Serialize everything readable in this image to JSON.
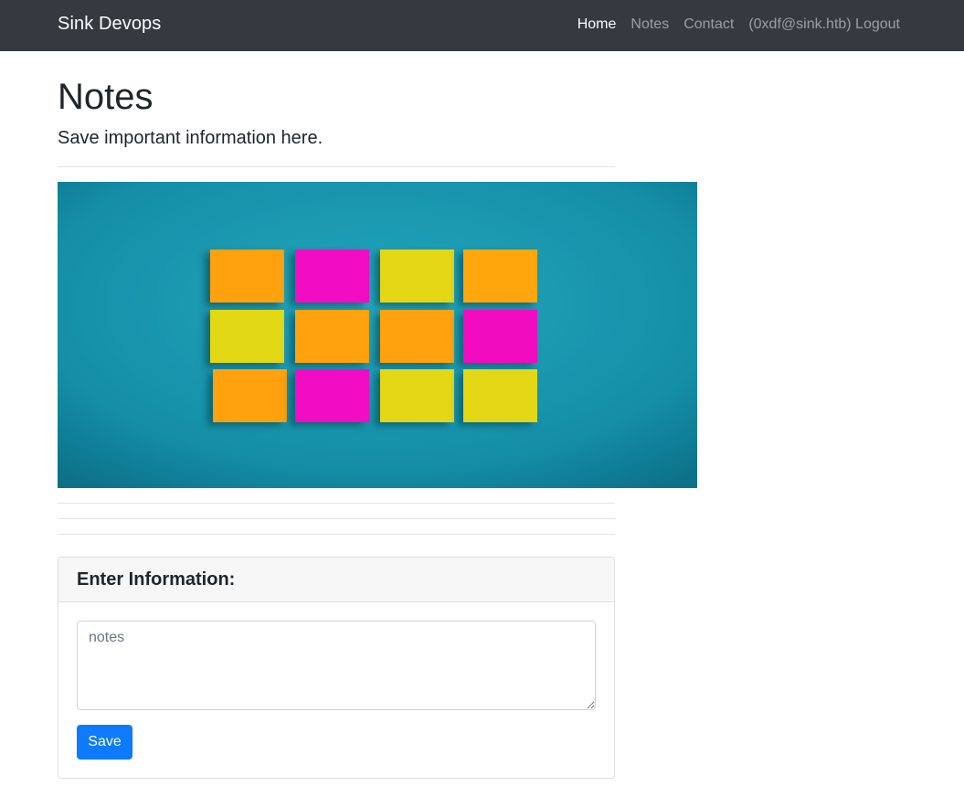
{
  "navbar": {
    "brand": "Sink Devops",
    "links": [
      {
        "label": "Home",
        "active": true
      },
      {
        "label": "Notes",
        "active": false
      },
      {
        "label": "Contact",
        "active": false
      },
      {
        "label": "(0xdf@sink.htb) Logout",
        "active": false
      }
    ]
  },
  "header": {
    "title": "Notes",
    "lead": "Save important information here."
  },
  "hero_image": {
    "background_color": "#1a9ab3",
    "note_colors": [
      [
        "#ffa20e",
        "#f20bc4",
        "#e3d718",
        "#ffa70a"
      ],
      [
        "#e3d818",
        "#ffa20e",
        "#ffa20e",
        "#f10bbf"
      ],
      [
        "#ffa20e",
        "#f20bc4",
        "#e3d718",
        "#e3d718"
      ]
    ]
  },
  "form": {
    "title": "Enter Information:",
    "notes_placeholder": "notes",
    "notes_value": "",
    "save_label": "Save"
  },
  "colors": {
    "navbar_bg": "#343a40",
    "primary": "#0d7bfb"
  }
}
